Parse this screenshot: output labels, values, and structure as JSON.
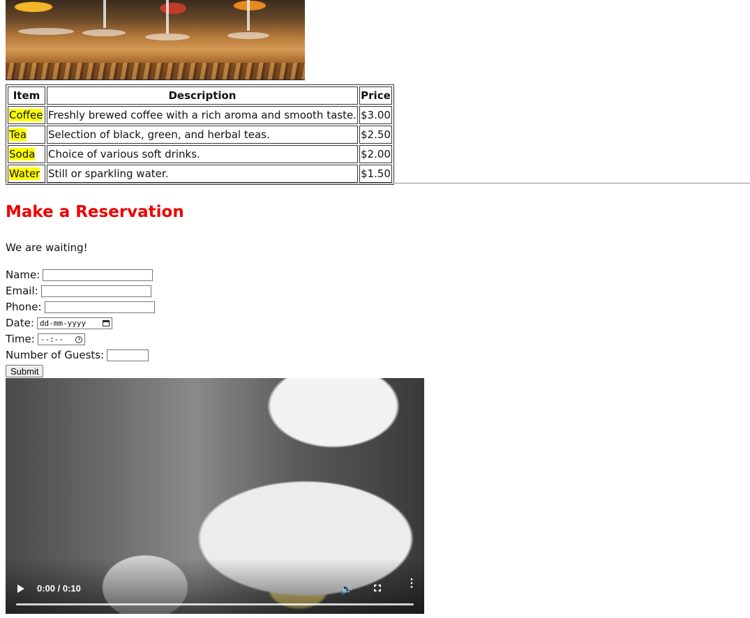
{
  "menu_table": {
    "headers": {
      "item": "Item",
      "description": "Description",
      "price": "Price"
    },
    "rows": [
      {
        "item": "Coffee",
        "description": "Freshly brewed coffee with a rich aroma and smooth taste.",
        "price": "$3.00"
      },
      {
        "item": "Tea",
        "description": "Selection of black, green, and herbal teas.",
        "price": "$2.50"
      },
      {
        "item": "Soda",
        "description": "Choice of various soft drinks.",
        "price": "$2.00"
      },
      {
        "item": "Water",
        "description": "Still or sparkling water.",
        "price": "$1.50"
      }
    ]
  },
  "reservation": {
    "title": "Make a Reservation",
    "lead": "We are waiting!",
    "fields": {
      "name_label": "Name:",
      "email_label": "Email:",
      "phone_label": "Phone:",
      "date_label": "Date:",
      "date_placeholder": "dd-mm-yyyy",
      "time_label": "Time:",
      "time_placeholder": "--:--",
      "guests_label": "Number of Guests:"
    },
    "submit_label": "Submit"
  },
  "video": {
    "time_readout": "0:00 / 0:10",
    "progress": 0
  },
  "colors": {
    "title": "#ee0000",
    "item_highlight": "#ffff00"
  },
  "icons": [
    "calendar-icon",
    "clock-icon",
    "play-icon",
    "volume-icon",
    "fullscreen-icon",
    "more-options-icon"
  ]
}
